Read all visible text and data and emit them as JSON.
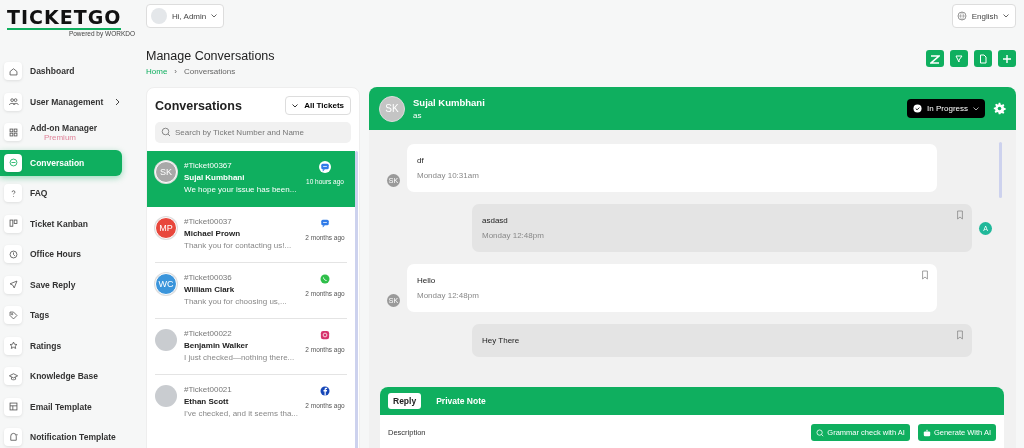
{
  "logo": {
    "name": "TICKETGO",
    "tagline": "Powered by WORKDO"
  },
  "sidebar": {
    "items": [
      {
        "label": "Dashboard",
        "kind": "home",
        "selected": false
      },
      {
        "label": "User Management",
        "kind": "users",
        "selected": false,
        "expandable": true
      },
      {
        "label": "Add-on Manager",
        "kind": "grid",
        "selected": false,
        "badge": "Premium"
      },
      {
        "label": "Conversation",
        "kind": "chat",
        "selected": true
      },
      {
        "label": "FAQ",
        "kind": "question",
        "selected": false
      },
      {
        "label": "Ticket Kanban",
        "kind": "kanban",
        "selected": false
      },
      {
        "label": "Office Hours",
        "kind": "clock",
        "selected": false
      },
      {
        "label": "Save Reply",
        "kind": "send",
        "selected": false
      },
      {
        "label": "Tags",
        "kind": "tag",
        "selected": false
      },
      {
        "label": "Ratings",
        "kind": "star",
        "selected": false
      },
      {
        "label": "Knowledge Base",
        "kind": "cap",
        "selected": false
      },
      {
        "label": "Email Template",
        "kind": "template",
        "selected": false
      },
      {
        "label": "Notification Template",
        "kind": "bell",
        "selected": false
      }
    ]
  },
  "topbar": {
    "user": "Hi, Admin",
    "language": "English"
  },
  "page": {
    "title": "Manage Conversations",
    "breadcrumb": [
      "Home",
      "›",
      "Conversations"
    ],
    "actions": [
      {
        "kind": "zendesk"
      },
      {
        "kind": "filter"
      },
      {
        "kind": "file"
      },
      {
        "kind": "plus"
      }
    ]
  },
  "conversations": {
    "title": "Conversations",
    "filter": "All Tickets",
    "search_placeholder": "Search by Ticket Number and Name",
    "items": [
      {
        "ticket": "#Ticket00367",
        "name": "Sujal Kumbhani",
        "preview": "We hope your issue has been...",
        "time": "10 hours ago",
        "kind": "chat",
        "avatar": {
          "kind": "initials",
          "text": "SK",
          "color": "#a8a8a8"
        },
        "selected": true
      },
      {
        "ticket": "#Ticket00037",
        "name": "Michael Prown",
        "preview": "Thank you for contacting us!...",
        "time": "2 months ago",
        "kind": "chat",
        "avatar": {
          "kind": "initials",
          "text": "MP",
          "color": "#e8473c"
        },
        "selected": false
      },
      {
        "ticket": "#Ticket00036",
        "name": "William Clark",
        "preview": "Thank you for choosing us,...",
        "time": "2 months ago",
        "kind": "whatsapp",
        "avatar": {
          "kind": "initials",
          "text": "WC",
          "color": "#3b95db"
        },
        "selected": false
      },
      {
        "ticket": "#Ticket00022",
        "name": "Benjamin Walker",
        "preview": "I just checked—nothing there...",
        "time": "2 months ago",
        "kind": "instagram",
        "avatar": {
          "kind": "photo"
        },
        "selected": false
      },
      {
        "ticket": "#Ticket00021",
        "name": "Ethan Scott",
        "preview": "I've checked, and it seems tha...",
        "time": "2 months ago",
        "kind": "facebook",
        "avatar": {
          "kind": "photo"
        },
        "selected": false
      }
    ]
  },
  "chat": {
    "avatar": "SK",
    "name": "Sujal Kumbhani",
    "subtitle": "as",
    "status": "In Progress",
    "messages": [
      {
        "kind": "incoming",
        "text": "df",
        "time": "Monday 10:31am",
        "avatar": "SK",
        "bookmark": false
      },
      {
        "kind": "outgoing",
        "text": "asdasd",
        "time": "Monday 12:48pm",
        "avatar": "A",
        "bookmark": true
      },
      {
        "kind": "incoming",
        "text": "Hello",
        "time": "Monday 12:48pm",
        "avatar": "SK",
        "bookmark": true
      },
      {
        "kind": "outgoing",
        "text": "Hey There",
        "bookmark": true
      }
    ]
  },
  "reply": {
    "tabs": [
      {
        "label": "Reply",
        "selected": true
      },
      {
        "label": "Private Note",
        "selected": false
      }
    ],
    "field_label": "Description",
    "buttons": [
      {
        "kind": "grammar",
        "label": "Grammar check with AI"
      },
      {
        "kind": "generate",
        "label": "Generate With AI"
      }
    ]
  }
}
